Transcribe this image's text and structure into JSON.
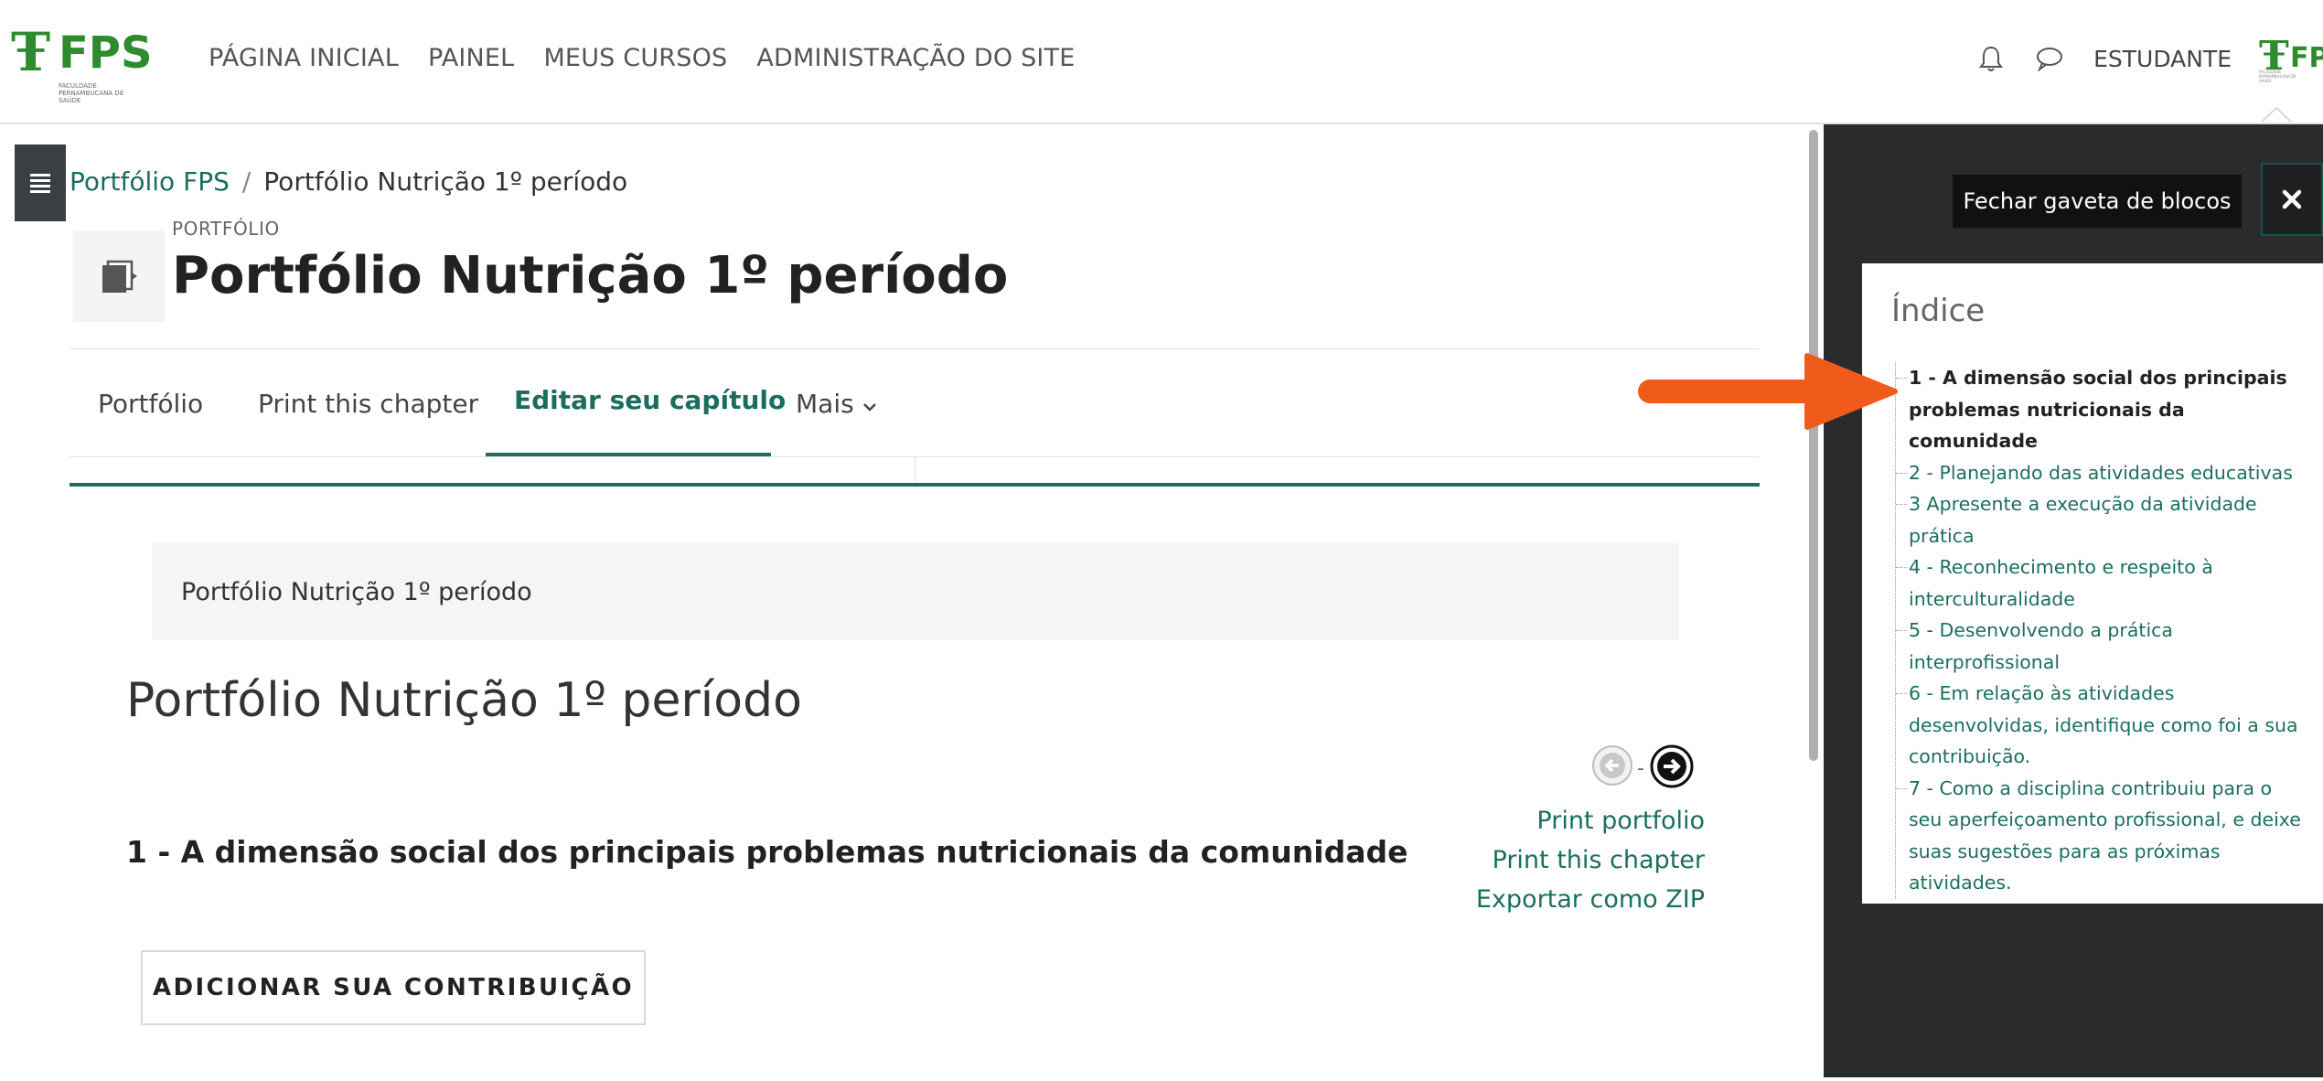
{
  "navbar": {
    "logo_text": "FPS",
    "logo_subtitle": "FACULDADE PERNAMBUCANA DE SAÚDE",
    "links": [
      "PÁGINA INICIAL",
      "PAINEL",
      "MEUS CURSOS",
      "ADMINISTRAÇÃO DO SITE"
    ],
    "user_name": "ESTUDANTE",
    "avatar_text": "FPS"
  },
  "breadcrumb": {
    "items": [
      "Portfólio FPS",
      "Portfólio Nutrição 1º período"
    ],
    "separator": "/"
  },
  "header": {
    "eyebrow": "PORTFÓLIO",
    "title": "Portfólio Nutrição 1º período"
  },
  "tabs": [
    {
      "label": "Portfólio"
    },
    {
      "label": "Print this chapter"
    },
    {
      "label": "Editar seu capítulo"
    },
    {
      "label": "Mais"
    }
  ],
  "content": {
    "summary": "Portfólio Nutrição 1º período",
    "title": "Portfólio Nutrição 1º período",
    "chapter_title": "1 - A dimensão social dos principais problemas nutricionais da comunidade",
    "nav_separator": "-",
    "side_links": [
      "Print portfolio",
      "Print this chapter",
      "Exportar como ZIP"
    ],
    "add_button": "ADICIONAR SUA CONTRIBUIÇÃO"
  },
  "drawer": {
    "tooltip": "Fechar gaveta de blocos",
    "index_title": "Índice",
    "index_items": [
      "1 - A dimensão social dos principais problemas nutricionais da comunidade",
      "2 - Planejando das atividades educativas",
      "3 Apresente a execução da atividade prática",
      "4 - Reconhecimento e respeito à interculturalidade",
      "5 - Desenvolvendo a prática interprofissional",
      "6 - Em relação às atividades desenvolvidas, identifique como foi a sua contribuição.",
      "7 - Como a disciplina contribuiu para o seu aperfeiçoamento profissional, e deixe suas sugestões para as próximas atividades."
    ],
    "current_index": 0
  },
  "colors": {
    "brand_green": "#2e8b2e",
    "link_teal": "#1b6e5e",
    "drawer_bg": "#2a2b2d",
    "annotation_arrow": "#f05a1a"
  }
}
